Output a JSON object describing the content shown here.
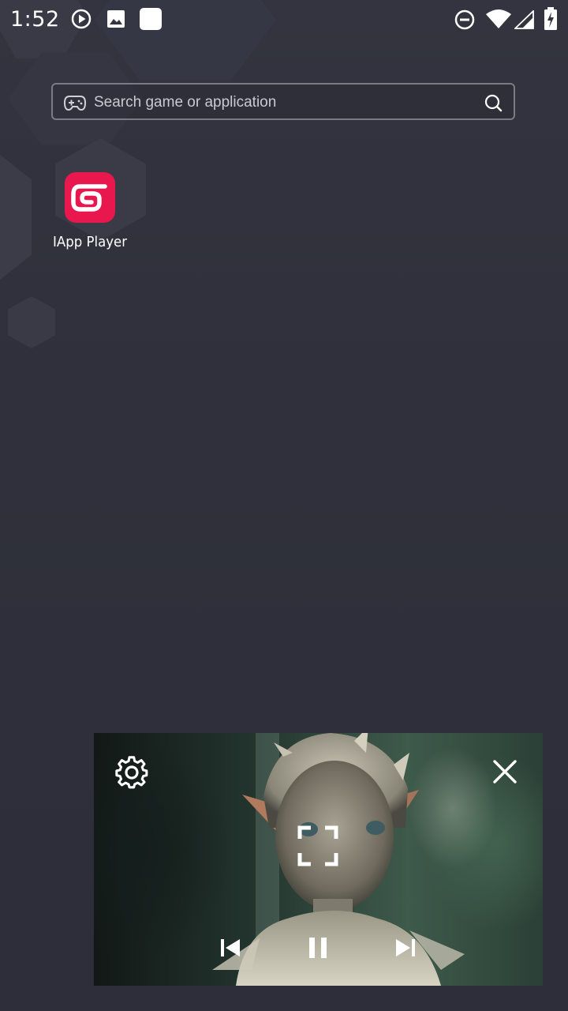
{
  "status_bar": {
    "time": "1:52",
    "icons": [
      "play-circle-icon",
      "image-icon",
      "app-square-icon",
      "do-not-disturb-icon",
      "wifi-icon",
      "signal-icon",
      "battery-charging-icon"
    ]
  },
  "search": {
    "placeholder": "Search game or application",
    "left_icon": "gamepad-icon",
    "right_icon": "search-icon"
  },
  "apps": [
    {
      "label": "IApp Player",
      "icon": "iapp-player-logo",
      "color": "#e8174d"
    }
  ],
  "player": {
    "controls": [
      "settings-icon",
      "close-icon",
      "fullscreen-icon",
      "skip-previous-icon",
      "pause-icon",
      "skip-next-icon"
    ],
    "state": "playing"
  },
  "colors": {
    "background": "#2e2f3a",
    "hexagon": "#3a3b47",
    "accent": "#e8174d",
    "text": "#ffffff"
  }
}
